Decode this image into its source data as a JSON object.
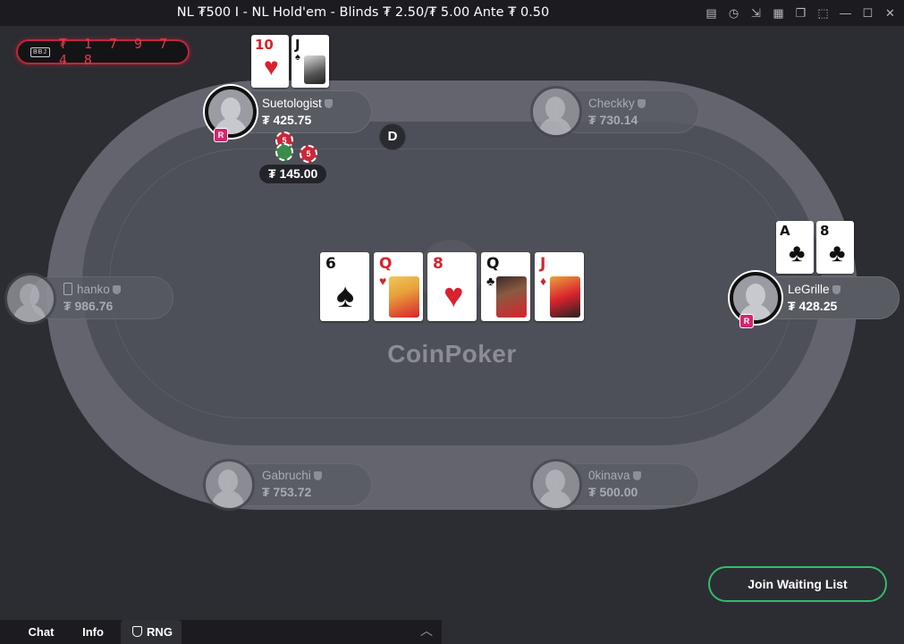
{
  "window": {
    "title": "NL ₮500 I - NL Hold'em - Blinds ₮ 2.50/₮ 5.00 Ante ₮ 0.50",
    "buttons": [
      "history-icon",
      "clock-icon",
      "import-icon",
      "grid-icon",
      "tables-icon",
      "crop-icon",
      "minimize-icon",
      "maximize-icon",
      "close-icon"
    ]
  },
  "jackpot": {
    "label": "BBJ",
    "value": "₮ 1 7 9 7 4 8"
  },
  "table": {
    "logo": "CoinPoker",
    "dealer": "D",
    "board": [
      {
        "rank": "6",
        "suit": "♠",
        "color": "black"
      },
      {
        "rank": "Q",
        "suit": "♥",
        "color": "red"
      },
      {
        "rank": "8",
        "suit": "♥",
        "color": "red"
      },
      {
        "rank": "Q",
        "suit": "♣",
        "color": "black"
      },
      {
        "rank": "J",
        "suit": "♦",
        "color": "red"
      }
    ]
  },
  "players": {
    "suetologist": {
      "name": "Suetologist",
      "stack": "₮ 425.75",
      "badge": "R",
      "cards": [
        {
          "rank": "10",
          "suit": "♥"
        },
        {
          "rank": "J",
          "suit": "♠"
        }
      ],
      "bet": "₮ 145.00",
      "chips": [
        "5",
        "5"
      ]
    },
    "checkky": {
      "name": "Checkky",
      "stack": "₮ 730.14"
    },
    "hanko": {
      "name": "hanko",
      "stack": "₮ 986.76"
    },
    "legrille": {
      "name": "LeGrille",
      "stack": "₮ 428.25",
      "badge": "R",
      "cards": [
        {
          "rank": "A",
          "suit": "♣"
        },
        {
          "rank": "8",
          "suit": "♣"
        }
      ]
    },
    "gabruchi": {
      "name": "Gabruchi",
      "stack": "₮ 753.72"
    },
    "okinava": {
      "name": "0kinava",
      "stack": "₮ 500.00"
    }
  },
  "actions": {
    "join_waiting_list": "Join Waiting List"
  },
  "bottom_tabs": {
    "chat": "Chat",
    "info": "Info",
    "rng": "RNG"
  },
  "colors": {
    "accent_green": "#2fbf6a",
    "badge_pink": "#d6246e",
    "jackpot_red": "#e03a4a"
  }
}
